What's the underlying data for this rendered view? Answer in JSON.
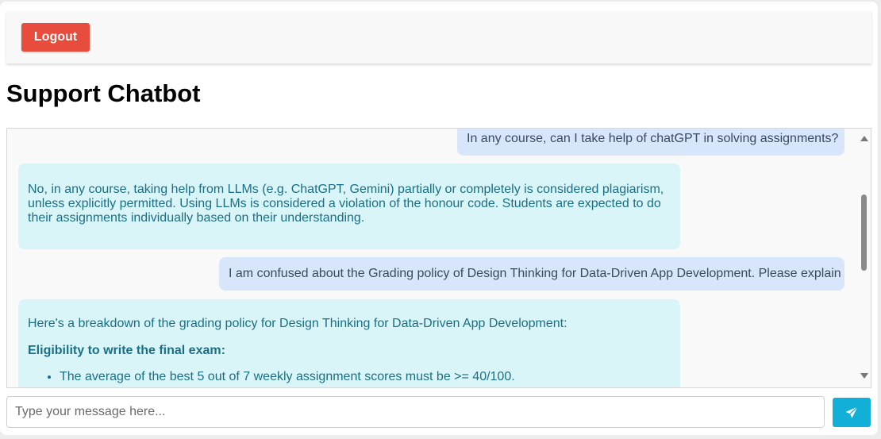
{
  "header": {
    "logout_label": "Logout"
  },
  "page_title": "Support Chatbot",
  "messages": [
    {
      "role": "user",
      "text": "In any course, can I take help of chatGPT in solving assignments?"
    },
    {
      "role": "bot",
      "text": "No, in any course, taking help from LLMs (e.g. ChatGPT, Gemini) partially or completely is considered plagiarism, unless explicitly permitted. Using LLMs is considered a violation of the honour code. Students are expected to do their assignments individually based on their understanding."
    },
    {
      "role": "user",
      "text": "I am confused about the Grading policy of Design Thinking for Data-Driven App Development. Please explain"
    },
    {
      "role": "bot",
      "intro": "Here's a breakdown of the grading policy for Design Thinking for Data-Driven App Development:",
      "heading": "Eligibility to write the final exam:",
      "bullets": [
        "The average of the best 5 out of 7 weekly assignment scores must be >= 40/100."
      ]
    }
  ],
  "composer": {
    "placeholder": "Type your message here...",
    "send_icon": "paper-plane-icon"
  },
  "colors": {
    "logout": "#e74c3c",
    "send": "#12b0d6",
    "user_bubble": "#d8e6fb",
    "bot_bubble": "#d9f5f7"
  }
}
